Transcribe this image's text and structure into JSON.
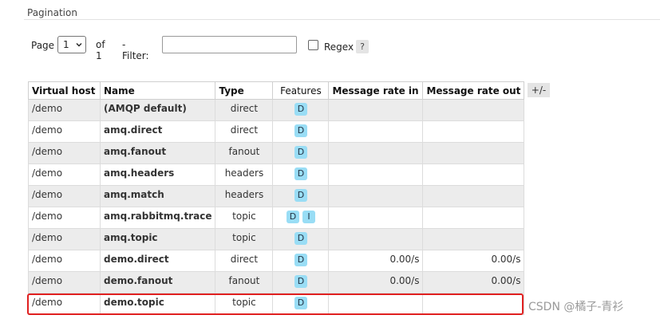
{
  "section": {
    "title": "Pagination"
  },
  "filter_bar": {
    "page_label": "Page",
    "page_value": "1",
    "of_label": "of 1",
    "filter_label": "- Filter:",
    "filter_value": "",
    "regex_label": "Regex",
    "help_label": "?"
  },
  "table": {
    "columns": [
      "Virtual host",
      "Name",
      "Type",
      "Features",
      "Message rate in",
      "Message rate out"
    ],
    "toggle_label": "+/-",
    "rows": [
      {
        "vhost": "/demo",
        "name": "(AMQP default)",
        "type": "direct",
        "features": [
          "D"
        ],
        "rate_in": "",
        "rate_out": ""
      },
      {
        "vhost": "/demo",
        "name": "amq.direct",
        "type": "direct",
        "features": [
          "D"
        ],
        "rate_in": "",
        "rate_out": ""
      },
      {
        "vhost": "/demo",
        "name": "amq.fanout",
        "type": "fanout",
        "features": [
          "D"
        ],
        "rate_in": "",
        "rate_out": ""
      },
      {
        "vhost": "/demo",
        "name": "amq.headers",
        "type": "headers",
        "features": [
          "D"
        ],
        "rate_in": "",
        "rate_out": ""
      },
      {
        "vhost": "/demo",
        "name": "amq.match",
        "type": "headers",
        "features": [
          "D"
        ],
        "rate_in": "",
        "rate_out": ""
      },
      {
        "vhost": "/demo",
        "name": "amq.rabbitmq.trace",
        "type": "topic",
        "features": [
          "D",
          "I"
        ],
        "rate_in": "",
        "rate_out": ""
      },
      {
        "vhost": "/demo",
        "name": "amq.topic",
        "type": "topic",
        "features": [
          "D"
        ],
        "rate_in": "",
        "rate_out": ""
      },
      {
        "vhost": "/demo",
        "name": "demo.direct",
        "type": "direct",
        "features": [
          "D"
        ],
        "rate_in": "0.00/s",
        "rate_out": "0.00/s"
      },
      {
        "vhost": "/demo",
        "name": "demo.fanout",
        "type": "fanout",
        "features": [
          "D"
        ],
        "rate_in": "0.00/s",
        "rate_out": "0.00/s"
      },
      {
        "vhost": "/demo",
        "name": "demo.topic",
        "type": "topic",
        "features": [
          "D"
        ],
        "rate_in": "",
        "rate_out": ""
      }
    ]
  },
  "watermark": "CSDN @橘子-青衫",
  "colors": {
    "badge": "#99ddf5",
    "highlight": "#e02020",
    "row_alt": "#ececec"
  },
  "icons": {
    "select_chevron": "chevron-down-icon"
  }
}
